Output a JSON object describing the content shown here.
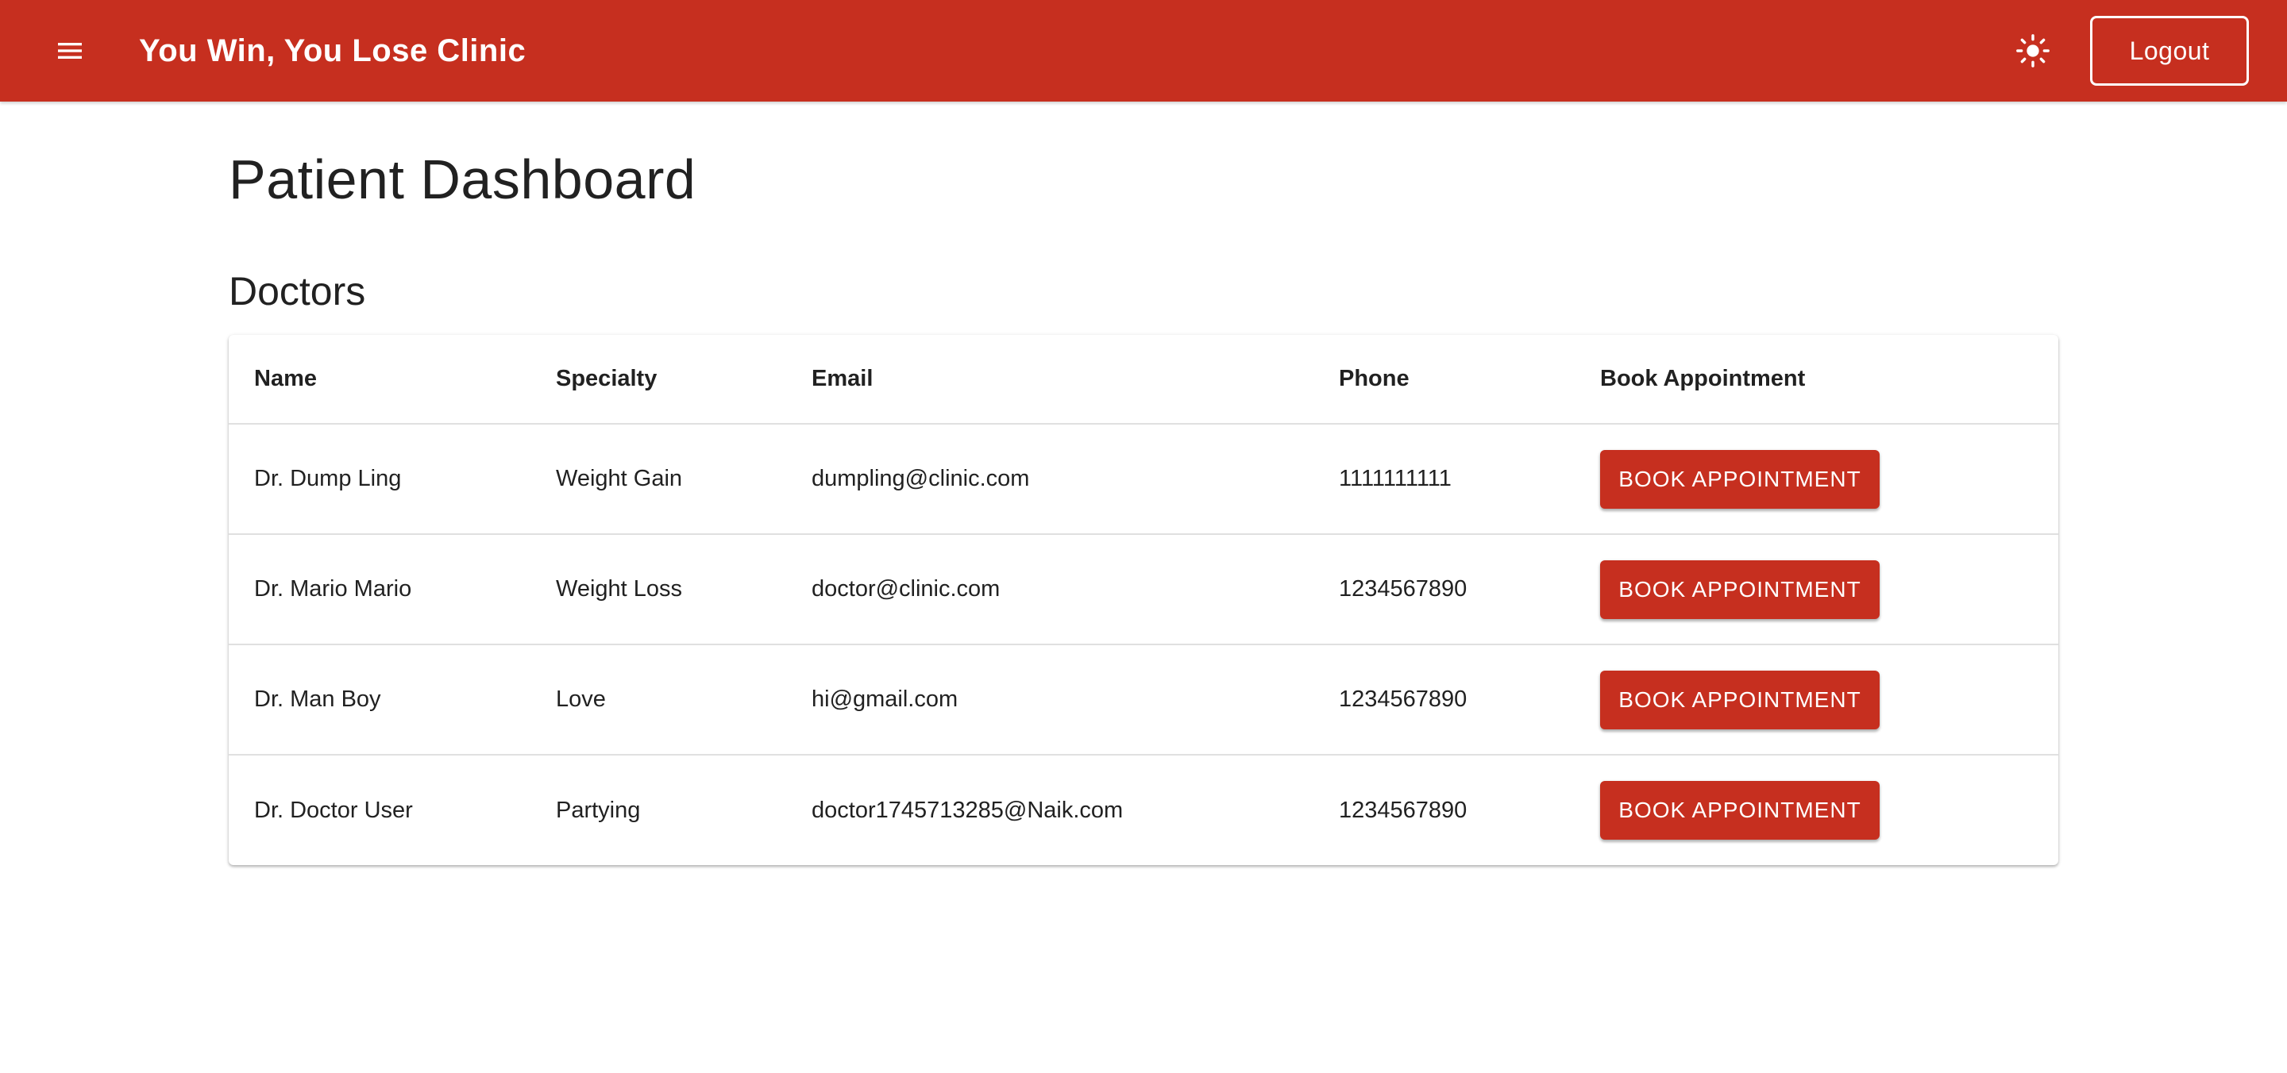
{
  "appbar": {
    "title": "You Win, You Lose Clinic",
    "menu_icon": "hamburger-menu-icon",
    "theme_icon": "sun-icon",
    "logout_label": "Logout",
    "background_color": "#c62f1f"
  },
  "page": {
    "title": "Patient Dashboard",
    "section_title": "Doctors"
  },
  "doctors_table": {
    "headers": [
      "Name",
      "Specialty",
      "Email",
      "Phone",
      "Book Appointment"
    ],
    "rows": [
      {
        "name": "Dr. Dump Ling",
        "specialty": "Weight Gain",
        "email": "dumpling@clinic.com",
        "phone": "1111111111",
        "action": "BOOK APPOINTMENT"
      },
      {
        "name": "Dr. Mario Mario",
        "specialty": "Weight Loss",
        "email": "doctor@clinic.com",
        "phone": "1234567890",
        "action": "BOOK APPOINTMENT"
      },
      {
        "name": "Dr. Man Boy",
        "specialty": "Love",
        "email": "hi@gmail.com",
        "phone": "1234567890",
        "action": "BOOK APPOINTMENT"
      },
      {
        "name": "Dr. Doctor User",
        "specialty": "Partying",
        "email": "doctor1745713285@Naik.com",
        "phone": "1234567890",
        "action": "BOOK APPOINTMENT"
      }
    ]
  },
  "colors": {
    "primary": "#c62f1f",
    "text": "#212121",
    "divider": "#e0e0e0"
  }
}
